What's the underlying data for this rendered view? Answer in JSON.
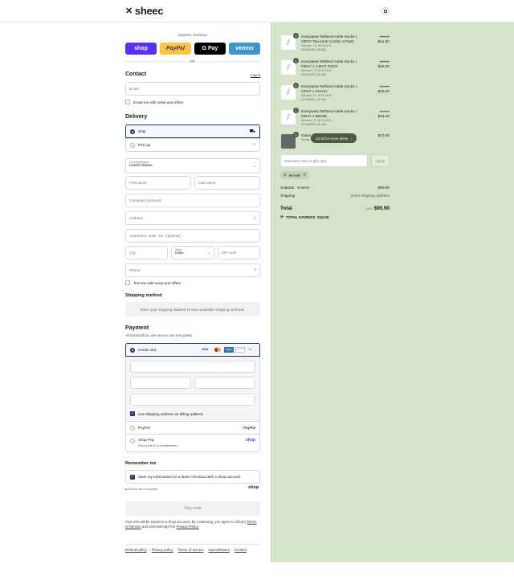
{
  "header": {
    "logo": "sheec"
  },
  "express": {
    "title": "Express checkout",
    "shop": "shop",
    "paypal": "PayPal",
    "gpay": "G Pay",
    "venmo": "venmo",
    "or": "OR"
  },
  "contact": {
    "title": "Contact",
    "login": "Log in",
    "email_placeholder": "Email",
    "news": "Email me with news and offers"
  },
  "delivery": {
    "title": "Delivery",
    "ship": "Ship",
    "pickup": "Pick up",
    "country_label": "Country/Region",
    "country": "United States",
    "first": "First name",
    "last": "Last name",
    "company": "Company (optional)",
    "address": "Address",
    "apt": "Apartment, suite, etc. (optional)",
    "city": "City",
    "state_label": "State",
    "state": "Iowa",
    "zip": "ZIP code",
    "phone": "Phone",
    "text_news": "Text me with news and offers"
  },
  "shipping": {
    "title": "Shipping method",
    "note": "Enter your shipping address to view available shipping methods."
  },
  "payment": {
    "title": "Payment",
    "subtitle": "All transactions are secure and encrypted.",
    "credit": "Credit card",
    "cards": [
      "VISA",
      "MC",
      "AMEX",
      "DISCOVER",
      "+4"
    ],
    "billing": "Use shipping address as billing address",
    "paypal": "PayPal",
    "paypal_logo": "PayPal",
    "shoppay": "Shop Pay",
    "shoppay_sub": "Pay in full or in installments",
    "shoppay_logo": "shop"
  },
  "remember": {
    "title": "Remember me",
    "save": "Save my information for a faster checkout with a Shop account",
    "secure": "Secure and encrypted",
    "shop_logo": "shop"
  },
  "pay_button": "Pay now",
  "legal": {
    "prefix": "Your info will be saved to a Shop account. By continuing, you agree to Shop's",
    "tos": "Terms of Service",
    "mid": "and acknowledge the",
    "privacy": "Privacy Policy."
  },
  "footer_links": [
    "Refund policy",
    "Privacy policy",
    "Terms of service",
    "Cancellations",
    "Contact"
  ],
  "cart": {
    "items": [
      {
        "qty": "1",
        "title": "Everywear Refined Ankle Socks | GRAY Two-tone Combo 3 Pairs",
        "variant": "Women / S: W 5.5-8.5",
        "discount": "9AANR (-$4.60)",
        "old": "$45.90",
        "price": "$41.30"
      },
      {
        "qty": "1",
        "title": "Everywear Refined Ankle Socks | GRAY x LIGHT GRAY",
        "variant": "Women / S: W 5.5-8.5",
        "discount": "9AANR (-$1.80)",
        "old": "$18.00",
        "price": "$16.20"
      },
      {
        "qty": "1",
        "title": "Everywear Refined Ankle Socks | GRAY x KHAKI",
        "variant": "Women / S: W 5.5-8.5",
        "discount": "9AANR (-$1.80)",
        "old": "$18.00",
        "price": "$16.20"
      },
      {
        "qty": "1",
        "title": "Everywear Refined Ankle Socks | GRAY x BEIGE",
        "variant": "Women / S: W 5.5-8.5",
        "discount": "9AANR (-$1.80)",
        "old": "$18.00",
        "price": "$16.20"
      },
      {
        "qty": "1",
        "title": "Glass ... for Feet | Super ...",
        "variant": "Screw Plus",
        "discount": "",
        "old": "",
        "price": "$10.00"
      }
    ],
    "scroll_hint": "Scroll for more items",
    "discount_placeholder": "Discount code or gift card",
    "apply": "Apply",
    "code": "9AANR",
    "subtotal_label": "Subtotal · 5 items",
    "subtotal": "$99.90",
    "shipping_label": "Shipping",
    "shipping_value": "Enter shipping address",
    "total_label": "Total",
    "currency": "USD",
    "total": "$99.90",
    "savings_label": "TOTAL SAVINGS",
    "savings": "$10.00"
  }
}
